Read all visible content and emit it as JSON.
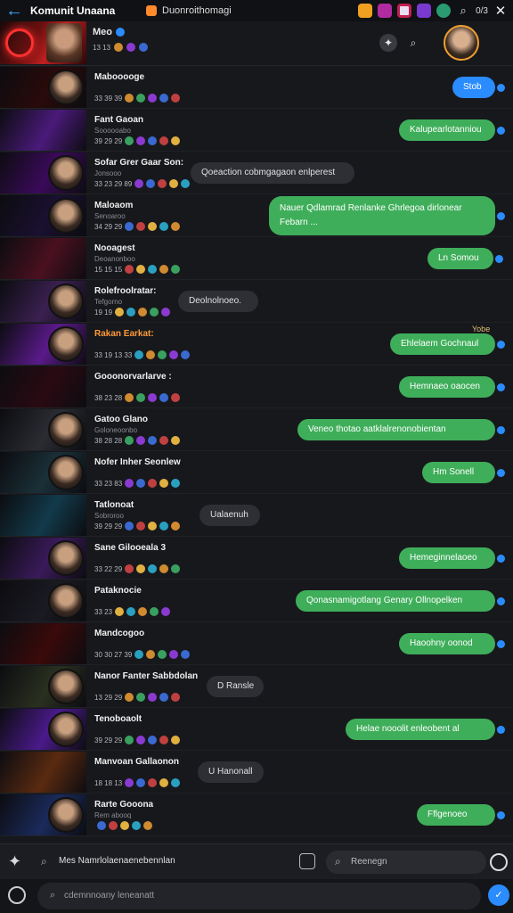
{
  "topbar": {
    "title": "Komunit Unaana",
    "channel": "Duonroithomagi",
    "count": "0/3"
  },
  "header": {
    "name": "Meo",
    "stats": "13  13"
  },
  "rows": [
    {
      "name": "Mabooooge",
      "tag": "",
      "stats": "33  39 39",
      "bubble": "Stob",
      "btype": "blue",
      "bx": 508,
      "bw": 48
    },
    {
      "name": "Fant Gaoan",
      "tag": "Soooooabo",
      "stats": "39  29  29",
      "bubble": "Kalupearlotanniou",
      "btype": "green",
      "bx": 448,
      "bw": 108
    },
    {
      "name": "Sofar Grer Gaar Son:",
      "tag": "Jonsooo",
      "stats": "33  23  29 89",
      "bubble": "Qoeaction cobmgagaon enlperest",
      "btype": "gray",
      "bx": 214,
      "bw": 184
    },
    {
      "name": "Maloaom",
      "tag": "Senoaroo",
      "stats": "34  29  29",
      "bubble": "Nauer Qdlamrad  Renlanke Ghrlegoa dirlonear Febarn ...",
      "btype": "green",
      "bx": 302,
      "bw": 254,
      "tall": true
    },
    {
      "name": "Nooagest",
      "tag": "Deoanonboo",
      "stats": "15  15  15",
      "bubble": "Ln Somou",
      "btype": "green",
      "bx": 480,
      "bw": 74
    },
    {
      "name": "Rolefroolratar:",
      "tag": "Tefgorno",
      "stats": "19  19",
      "bubble": "Deolnolnoeo.",
      "btype": "gray",
      "bx": 200,
      "bw": 90
    },
    {
      "name": "Rakan Earkat:",
      "tag": "",
      "stats": "33  19  13  33",
      "bubble": "Ehlelaem Gochnaul",
      "btype": "green",
      "bx": 438,
      "bw": 118,
      "orange": true
    },
    {
      "name": "Gooonorvarlarve :",
      "tag": "",
      "stats": "38  23  28",
      "bubble": "Hemnaeo oaocen",
      "btype": "green",
      "bx": 448,
      "bw": 108
    },
    {
      "name": "Gatoo Glano",
      "tag": "Goloneoonbo",
      "stats": "38  28  28",
      "bubble": "Veneo thotao  aatklalrenonobientan",
      "btype": "green",
      "bx": 334,
      "bw": 222
    },
    {
      "name": "Nofer Inher Seonlew",
      "tag": "",
      "stats": "33  23  83",
      "bubble": "Hm Sonell",
      "btype": "green",
      "bx": 474,
      "bw": 82
    },
    {
      "name": "Tatlonoat",
      "tag": "Sobroroo",
      "stats": "39  29  29",
      "bubble": "Ualaenuh",
      "btype": "gray",
      "bx": 224,
      "bw": 68
    },
    {
      "name": "Sane Gilooeala  3",
      "tag": "",
      "stats": "33  22  29",
      "bubble": "Hemeginnelaoeo",
      "btype": "green",
      "bx": 448,
      "bw": 108
    },
    {
      "name": "Pataknocie",
      "tag": "",
      "stats": "33  23",
      "bubble": "Qonasnamigotlang Genary Ollnopelken",
      "btype": "green",
      "bx": 332,
      "bw": 224
    },
    {
      "name": "Mandcogoo",
      "tag": "",
      "stats": "30  30 27 39",
      "bubble": "Haoohny oonod",
      "btype": "green",
      "bx": 448,
      "bw": 108
    },
    {
      "name": "Nanor Fanter Sabbdolan",
      "tag": "",
      "stats": "13  29  29",
      "bubble": "D Ransle",
      "btype": "gray",
      "bx": 232,
      "bw": 64
    },
    {
      "name": "Tenoboaolt",
      "tag": "",
      "stats": "39  29 29",
      "bubble": "Helae nooolit enleobent al",
      "btype": "green",
      "bx": 388,
      "bw": 168
    },
    {
      "name": "Manvoan Gallaonon",
      "tag": "",
      "stats": "18  18  13",
      "bubble": "U Hanonall",
      "btype": "gray",
      "bx": 222,
      "bw": 74
    },
    {
      "name": "Rarte Gooona",
      "tag": "Rem abooq",
      "stats": "",
      "bubble": "Fflgenoeo",
      "btype": "green",
      "bx": 468,
      "bw": 88
    }
  ],
  "reply_note": "Yobe",
  "searchbar": {
    "text": "Mes Namrlolaenaenebennlan",
    "search_placeholder": "Reenegn"
  },
  "composer": {
    "placeholder": "cdemnnoany leneanatt"
  },
  "thumb_colors": [
    "#2a0a0a",
    "#4a1a7a",
    "#3a0a5a",
    "#1a1030",
    "#4a1020",
    "#3a2050",
    "#5a1a8a",
    "#2a0a12",
    "#2a2c32",
    "#1a3038",
    "#123a4a",
    "#3a1a5a",
    "#1a1a22",
    "#3a0a0a",
    "#2a3020",
    "#4a1a8a",
    "#5a2a10",
    "#1a2a5a"
  ]
}
